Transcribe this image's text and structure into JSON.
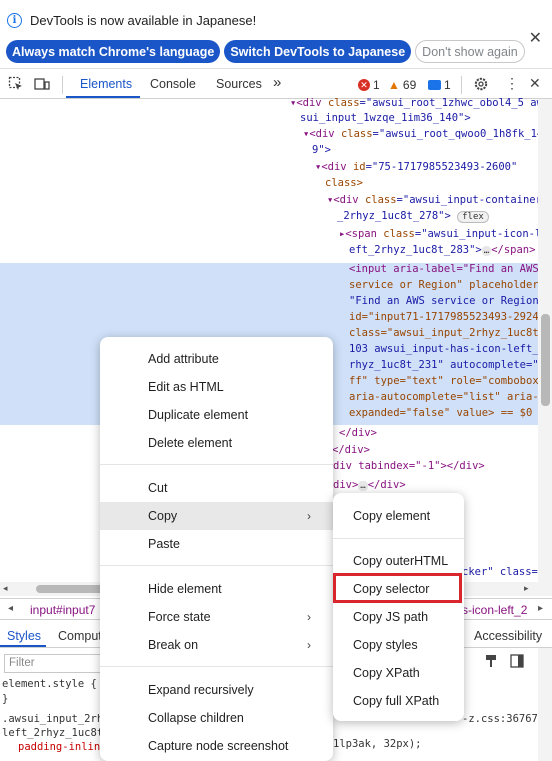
{
  "infobar": {
    "message": "DevTools is now available in Japanese!",
    "match_language_button": "Always match Chrome's language",
    "switch_button": "Switch DevTools to Japanese",
    "dismiss_button": "Don't show again",
    "close_glyph": "✕"
  },
  "tabs": {
    "elements": "Elements",
    "console": "Console",
    "sources": "Sources",
    "more": "»"
  },
  "status": {
    "errors": "1",
    "warnings": "69",
    "messages": "1"
  },
  "dom": {
    "l1": [
      "<div ",
      "class",
      "=\"",
      "awsui_root_1zhwc_obol4_5 aw",
      ""
    ],
    "l2": "sui_input_1wzqe_1im36_140\">",
    "l3_tag": "<div ",
    "l3_attr": "class",
    "l3_val": "=\"awsui_root_qwoo0_1h8fk_14",
    "l4": "9\">",
    "l5_tag": "<div ",
    "l5_attr": "id",
    "l5_val": "=\"75-1717985523493-2600\"",
    "l6": "class>",
    "l7_tag": "<div ",
    "l7_attr": "class",
    "l7_val": "=\"awsui_input-container",
    "l8": "_2rhyz_1uc8t_278\">",
    "l8_badge": "flex",
    "l9_tag": "<span ",
    "l9_attr": "class",
    "l9_val": "=\"awsui_input-icon-l",
    "l10": "eft_2rhyz_1uc8t_283\">",
    "l10_badge": "…",
    "l10_end": "</span>",
    "sel1": "<input aria-label=\"Find an AWS",
    "sel2": "service or Region\" placeholder=",
    "sel3": "\"Find an AWS service or Region\"",
    "sel4": "id=\"input71-1717985523493-2924\"",
    "sel5": "class=\"awsui_input_2rhyz_1uc8t_",
    "sel6": "103 awsui_input-has-icon-left_2",
    "sel7": "rhyz_1uc8t_231\" autocomplete=\"o",
    "sel8": "ff\" type=\"text\" role=\"combobox\"",
    "sel9": "aria-autocomplete=\"list\" aria-",
    "sel10": "expanded=\"false\" value> == $0",
    "c1": "</div>",
    "c2": "</div>",
    "c3": "div tabindex=\"-1\"></div>",
    "c4_a": "div>",
    "c4_badge": "…",
    "c4_b": "</div>",
    "frag_right": "cker\" class=",
    "frag_style": "-z.css:36767",
    "frag_style2": "1lp3ak, 32px);"
  },
  "breadcrumbs": {
    "left": "input#input7",
    "right": "s-icon-left_2"
  },
  "styles_tabs": {
    "styles": "Styles",
    "computed": "Comput",
    "accessibility": "Accessibility"
  },
  "styles": {
    "filter_placeholder": "Filter",
    "l1": "element.style {",
    "l2": "}",
    "l3": ".awsui_input_2rhy",
    "l4": "left_2rhyz_1uc8t_",
    "l5": "padding-inlin"
  },
  "context_menu": {
    "items": [
      "Add attribute",
      "Edit as HTML",
      "Duplicate element",
      "Delete element",
      "Cut",
      "Copy",
      "Paste",
      "Hide element",
      "Force state",
      "Break on",
      "Expand recursively",
      "Collapse children",
      "Capture node screenshot"
    ]
  },
  "copy_submenu": {
    "items": [
      "Copy element",
      "Copy outerHTML",
      "Copy selector",
      "Copy JS path",
      "Copy styles",
      "Copy XPath",
      "Copy full XPath"
    ]
  },
  "colors": {
    "accent": "#1a56c8",
    "selection": "#cfe0f8",
    "highlight_box": "#d9262c"
  }
}
